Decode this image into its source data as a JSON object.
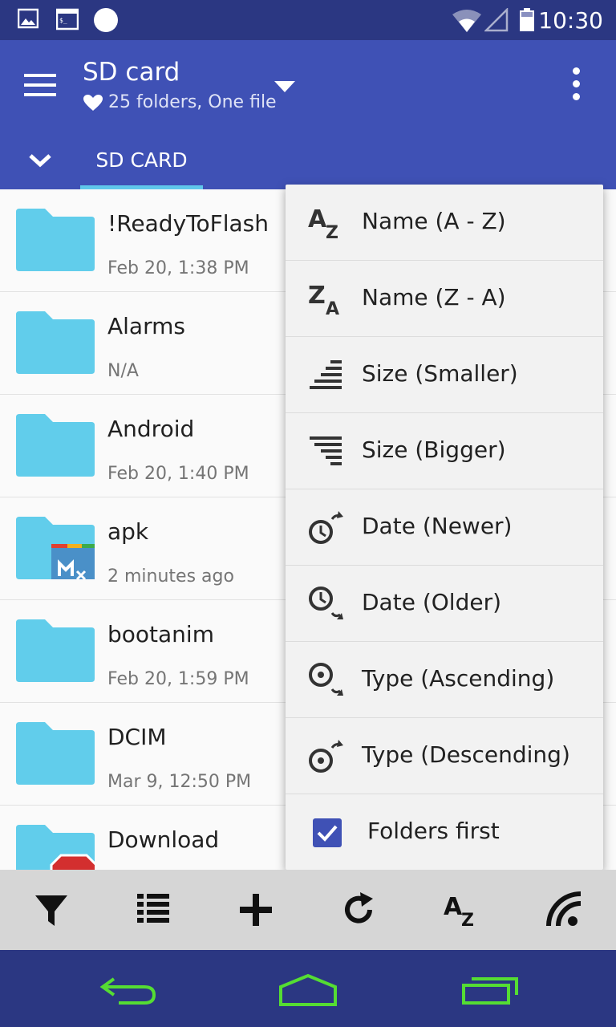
{
  "status_bar": {
    "time": "10:30",
    "icons": [
      "image-icon",
      "terminal-icon",
      "circle-icon",
      "wifi-icon",
      "cell-signal-icon",
      "battery-icon"
    ]
  },
  "app_bar": {
    "title": "SD card",
    "subtitle": "25 folders, One file",
    "tab_label": "SD CARD",
    "colors": {
      "primary": "#3f51b5",
      "status": "#2b3782",
      "accent": "#5fc7ea"
    }
  },
  "files": [
    {
      "name": "!ReadyToFlash",
      "date": "Feb 20, 1:38 PM",
      "icon": "folder-icon"
    },
    {
      "name": "Alarms",
      "date": "N/A",
      "icon": "folder-icon"
    },
    {
      "name": "Android",
      "date": "Feb 20, 1:40 PM",
      "icon": "folder-icon"
    },
    {
      "name": "apk",
      "date": "2 minutes ago",
      "icon": "folder-apk-icon"
    },
    {
      "name": "bootanim",
      "date": "Feb 20, 1:59 PM",
      "icon": "folder-icon"
    },
    {
      "name": "DCIM",
      "date": "Mar 9, 12:50 PM",
      "icon": "folder-icon"
    },
    {
      "name": "Download",
      "date": "",
      "icon": "folder-download-icon"
    }
  ],
  "sort_menu": {
    "items": [
      {
        "label": "Name (A - Z)",
        "icon": "sort-az-icon"
      },
      {
        "label": "Name (Z - A)",
        "icon": "sort-za-icon"
      },
      {
        "label": "Size (Smaller)",
        "icon": "size-smaller-icon"
      },
      {
        "label": "Size (Bigger)",
        "icon": "size-bigger-icon"
      },
      {
        "label": "Date (Newer)",
        "icon": "date-newer-icon"
      },
      {
        "label": "Date (Older)",
        "icon": "date-older-icon"
      },
      {
        "label": "Type (Ascending)",
        "icon": "type-ascending-icon"
      },
      {
        "label": "Type (Descending)",
        "icon": "type-descending-icon"
      }
    ],
    "folders_first": {
      "label": "Folders first",
      "checked": true
    }
  },
  "toolbar": {
    "buttons": [
      "filter-icon",
      "list-view-icon",
      "add-icon",
      "refresh-icon",
      "sort-icon",
      "cast-icon"
    ]
  },
  "nav_bar": {
    "buttons": [
      "back-icon",
      "home-icon",
      "recents-icon"
    ],
    "color": "#55dd33"
  }
}
